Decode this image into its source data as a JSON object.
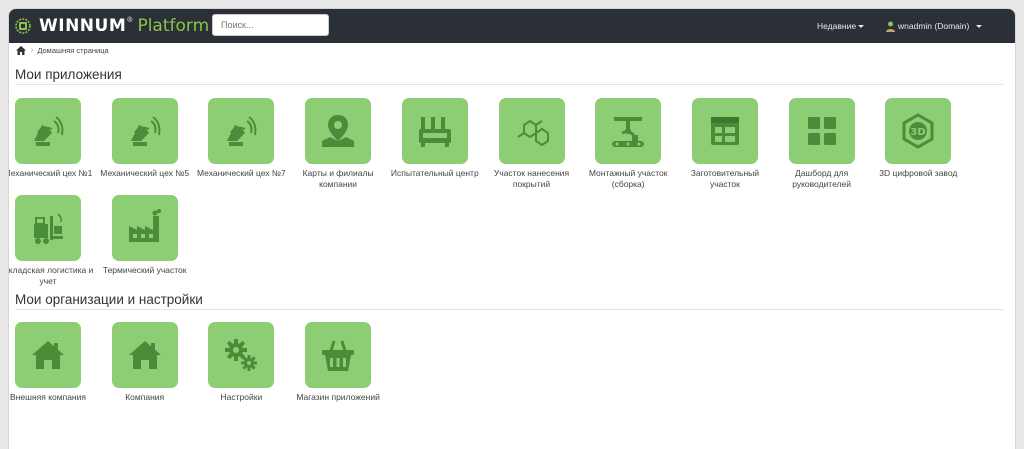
{
  "header": {
    "logo_word": "WINNUM",
    "logo_tm": "®",
    "logo_platform": "Platform",
    "search_placeholder": "Поиск...",
    "recent_label": "Недавние",
    "user_label": "wnadmin (Domain)"
  },
  "breadcrumb": {
    "home_icon": "home-icon",
    "current": "Домашняя страница"
  },
  "colors": {
    "topbar": "#2b3036",
    "accent": "#8bc34a",
    "tile": "#8dce74",
    "tile_icon": "#4a8c3a"
  },
  "apps": {
    "title": "Мои приложения",
    "items": [
      {
        "label": "Механический цех №1",
        "icon": "satellite-dish-icon"
      },
      {
        "label": "Механический цех №5",
        "icon": "satellite-dish-icon"
      },
      {
        "label": "Механический цех №7",
        "icon": "satellite-dish-icon"
      },
      {
        "label": "Карты и филиалы компании",
        "icon": "map-marker-icon"
      },
      {
        "label": "Испытательный центр",
        "icon": "test-bench-icon"
      },
      {
        "label": "Участок нанесения покрытий",
        "icon": "molecule-icon"
      },
      {
        "label": "Монтажный участок (сборка)",
        "icon": "robot-arm-icon"
      },
      {
        "label": "Заготовительный участок",
        "icon": "window-grid-icon"
      },
      {
        "label": "Дашборд для руководителей",
        "icon": "dashboard-grid-icon"
      },
      {
        "label": "3D цифровой завод",
        "icon": "3d-cube-icon"
      },
      {
        "label": "Складская логистика и учет",
        "icon": "forklift-icon"
      },
      {
        "label": "Термический участок",
        "icon": "factory-icon"
      }
    ]
  },
  "orgs": {
    "title": "Мои организации и настройки",
    "items": [
      {
        "label": "Внешняя компания",
        "icon": "house-icon"
      },
      {
        "label": "Компания",
        "icon": "house-icon"
      },
      {
        "label": "Настройки",
        "icon": "gears-icon"
      },
      {
        "label": "Магазин приложений",
        "icon": "shopping-basket-icon"
      }
    ]
  }
}
